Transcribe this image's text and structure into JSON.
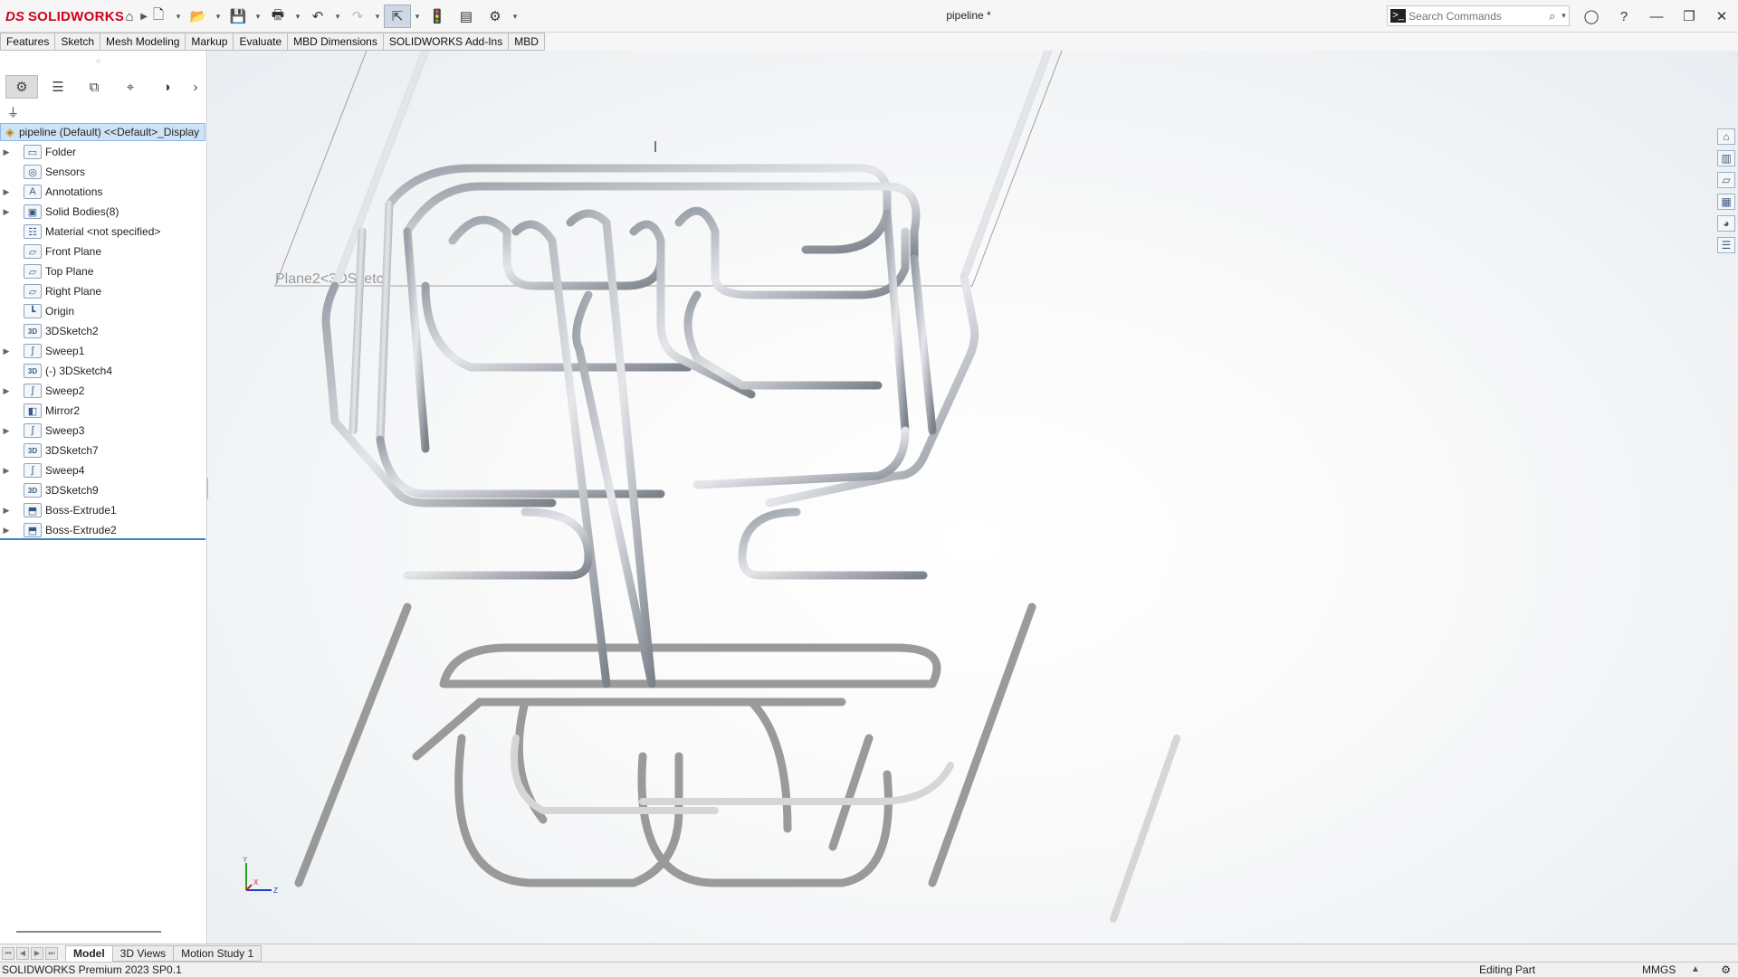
{
  "app": {
    "logo_ds": "DS",
    "logo_name": "SOLIDWORKS",
    "doc_title": "pipeline *",
    "brand_color": "#d0021b"
  },
  "quick_access": {
    "icons": [
      "home-icon",
      "new-file-icon",
      "open-file-icon",
      "save-icon",
      "print-icon",
      "undo-icon",
      "redo-icon",
      "select-arrow-icon",
      "traffic-light-icon",
      "file-properties-icon",
      "options-gear-icon"
    ]
  },
  "search": {
    "placeholder": "Search Commands"
  },
  "ribbon_tabs": [
    {
      "label": "Features"
    },
    {
      "label": "Sketch"
    },
    {
      "label": "Mesh Modeling"
    },
    {
      "label": "Markup"
    },
    {
      "label": "Evaluate"
    },
    {
      "label": "MBD Dimensions"
    },
    {
      "label": "SOLIDWORKS Add-Ins"
    },
    {
      "label": "MBD"
    }
  ],
  "feature_tree": {
    "root": "pipeline (Default) <<Default>_Display",
    "items": [
      {
        "label": "Folder",
        "expandable": true,
        "icon": "folder-icon"
      },
      {
        "label": "Sensors",
        "expandable": false,
        "icon": "sensor-icon"
      },
      {
        "label": "Annotations",
        "expandable": true,
        "icon": "annotation-icon"
      },
      {
        "label": "Solid Bodies(8)",
        "expandable": true,
        "icon": "solid-bodies-icon"
      },
      {
        "label": "Material <not specified>",
        "expandable": false,
        "icon": "material-icon"
      },
      {
        "label": "Front Plane",
        "expandable": false,
        "icon": "plane-icon"
      },
      {
        "label": "Top Plane",
        "expandable": false,
        "icon": "plane-icon"
      },
      {
        "label": "Right Plane",
        "expandable": false,
        "icon": "plane-icon"
      },
      {
        "label": "Origin",
        "expandable": false,
        "icon": "origin-icon"
      },
      {
        "label": "3DSketch2",
        "expandable": false,
        "icon": "3d-sketch-icon"
      },
      {
        "label": "Sweep1",
        "expandable": true,
        "icon": "sweep-icon"
      },
      {
        "label": "(-) 3DSketch4",
        "expandable": false,
        "icon": "3d-sketch-icon"
      },
      {
        "label": "Sweep2",
        "expandable": true,
        "icon": "sweep-icon"
      },
      {
        "label": "Mirror2",
        "expandable": false,
        "icon": "mirror-icon"
      },
      {
        "label": "Sweep3",
        "expandable": true,
        "icon": "sweep-icon"
      },
      {
        "label": "3DSketch7",
        "expandable": false,
        "icon": "3d-sketch-icon"
      },
      {
        "label": "Sweep4",
        "expandable": true,
        "icon": "sweep-icon"
      },
      {
        "label": "3DSketch9",
        "expandable": false,
        "icon": "3d-sketch-icon"
      },
      {
        "label": "Boss-Extrude1",
        "expandable": true,
        "icon": "extrude-icon"
      },
      {
        "label": "Boss-Extrude2",
        "expandable": true,
        "icon": "extrude-icon"
      }
    ]
  },
  "viewport": {
    "plane_label": "Plane2<3DSketc",
    "triad_y": "Y",
    "triad_x": "X",
    "triad_z": "Z"
  },
  "bottom_tabs": [
    {
      "label": "Model",
      "active": true
    },
    {
      "label": "3D Views",
      "active": false
    },
    {
      "label": "Motion Study 1",
      "active": false
    }
  ],
  "status_bar": {
    "version": "SOLIDWORKS Premium 2023 SP0.1",
    "mode": "Editing Part",
    "units": "MMGS"
  }
}
